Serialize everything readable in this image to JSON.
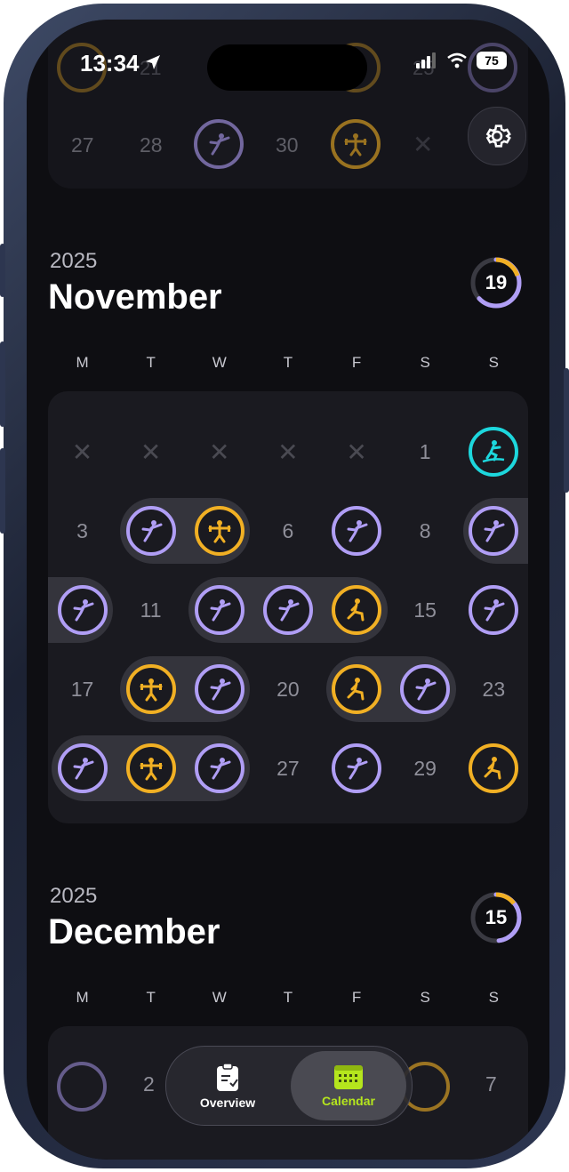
{
  "status": {
    "time": "13:34",
    "battery": "75"
  },
  "top_partial": {
    "row1": [
      "21",
      "25"
    ],
    "row2": [
      "27",
      "28",
      "30"
    ]
  },
  "months": [
    {
      "year": "2025",
      "name": "November",
      "count": "19",
      "count_fraction": 0.63
    },
    {
      "year": "2025",
      "name": "December",
      "count": "15",
      "count_fraction": 0.48
    }
  ],
  "weekdays": [
    "M",
    "T",
    "W",
    "T",
    "F",
    "S",
    "S"
  ],
  "november": {
    "dates": {
      "d1": "1",
      "d3": "3",
      "d6": "6",
      "d8": "8",
      "d11": "11",
      "d15": "15",
      "d17": "17",
      "d20": "20",
      "d23": "23",
      "d27": "27",
      "d29": "29"
    }
  },
  "december_partial": {
    "d2": "2",
    "d7": "7"
  },
  "tabs": {
    "overview": "Overview",
    "calendar": "Calendar"
  },
  "colors": {
    "purple": "#b09ef5",
    "orange": "#f1b024",
    "cyan": "#1dd7dd",
    "accent_green": "#b5e61d"
  },
  "icons": {
    "kick": "kick-icon",
    "lift": "weightlifting-icon",
    "lunge": "lunge-icon",
    "surf": "surf-icon",
    "gear": "gear-icon",
    "overview": "clipboard-icon",
    "calendar": "calendar-icon"
  }
}
